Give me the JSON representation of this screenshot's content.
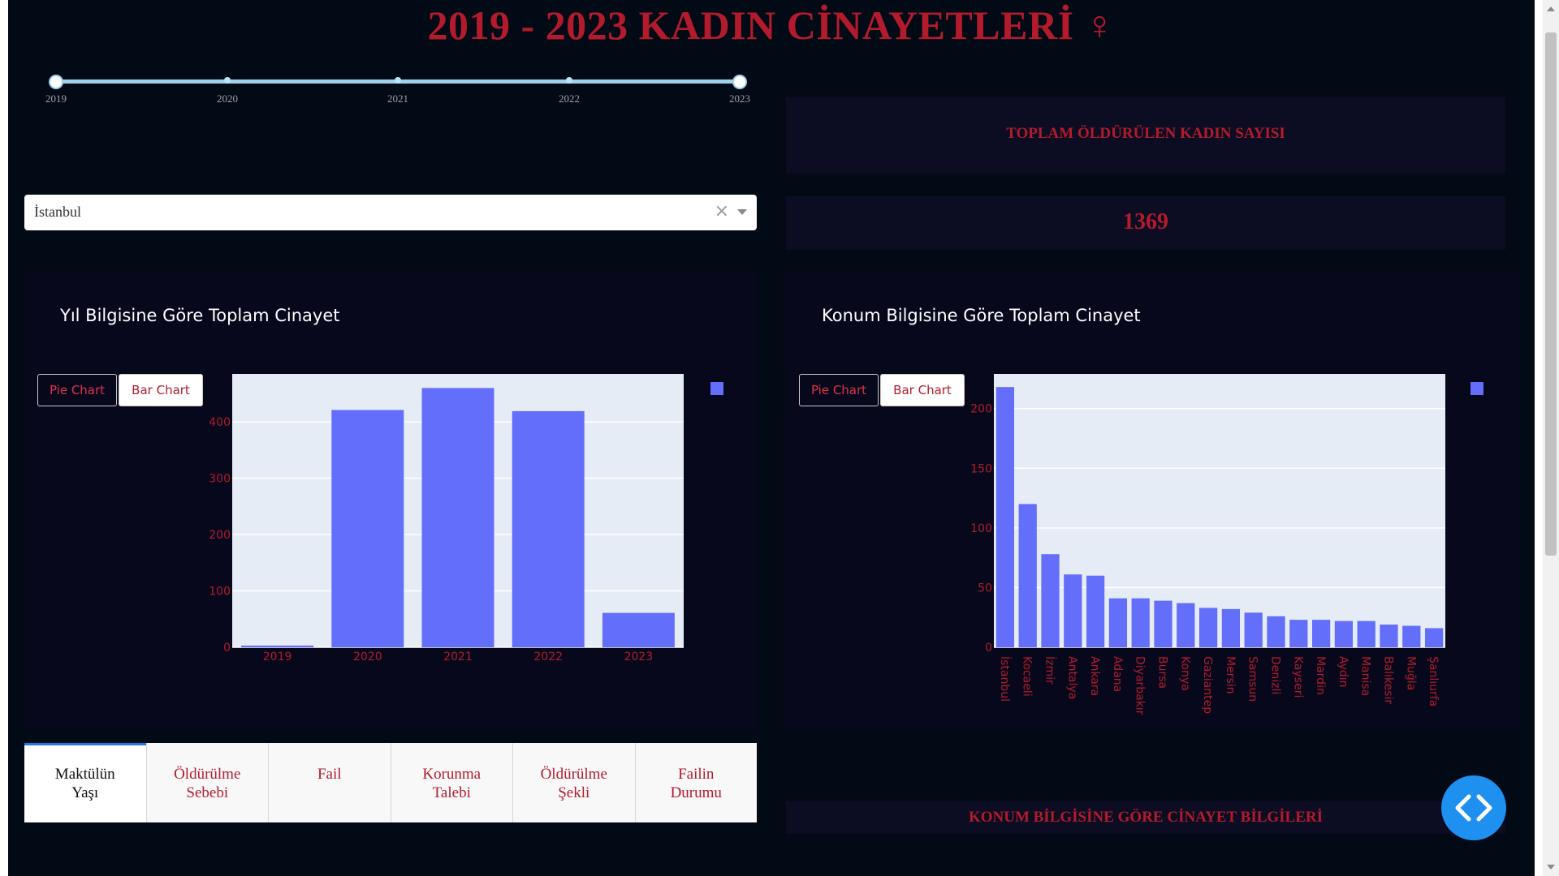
{
  "header": {
    "title": "2019 - 2023 KADIN CİNAYETLERİ ♀"
  },
  "slider": {
    "marks": [
      "2019",
      "2020",
      "2021",
      "2022",
      "2023"
    ],
    "selected_range": [
      "2019",
      "2023"
    ]
  },
  "dropdown": {
    "value": "İstanbul",
    "clear_symbol": "×"
  },
  "kpi": {
    "label": "TOPLAM ÖLDÜRÜLEN KADIN SAYISI",
    "value": "1369"
  },
  "left_panel": {
    "title": "Yıl Bilgisine Göre Toplam Cinayet",
    "pie_button": "Pie Chart",
    "bar_button": "Bar Chart"
  },
  "right_panel": {
    "title": "Konum Bilgisine Göre Toplam Cinayet",
    "pie_button": "Pie Chart",
    "bar_button": "Bar Chart"
  },
  "tabs": [
    {
      "line1": "Maktülün",
      "line2": "Yaşı"
    },
    {
      "line1": "Öldürülme",
      "line2": "Sebebi"
    },
    {
      "line1": "Fail",
      "line2": ""
    },
    {
      "line1": "Korunma",
      "line2": "Talebi"
    },
    {
      "line1": "Öldürülme",
      "line2": "Şekli"
    },
    {
      "line1": "Failin",
      "line2": "Durumu"
    }
  ],
  "active_tab": 0,
  "location_info_title": "KONUM BİLGİSİNE GÖRE CİNAYET BİLGİLERİ",
  "colors": {
    "accent": "#b31b2c",
    "bar": "#636efa",
    "plot_bg": "#e5ecf6",
    "panel_bg": "#07081c"
  },
  "chart_data": [
    {
      "type": "bar",
      "categories": [
        "2019",
        "2020",
        "2021",
        "2022",
        "2023"
      ],
      "values": [
        3,
        421,
        460,
        419,
        61
      ],
      "ylim": [
        0,
        485
      ],
      "yticks": [
        0,
        100,
        200,
        300,
        400
      ],
      "grid": true,
      "legend": "top-right"
    },
    {
      "type": "bar",
      "categories": [
        "İstanbul",
        "Kocaeli",
        "İzmir",
        "Antalya",
        "Ankara",
        "Adana",
        "Diyarbakır",
        "Bursa",
        "Konya",
        "Gaziantep",
        "Mersin",
        "Samsun",
        "Denizli",
        "Kayseri",
        "Mardin",
        "Aydın",
        "Manisa",
        "Balıkesir",
        "Muğla",
        "Şanlıurfa"
      ],
      "values": [
        218,
        120,
        78,
        61,
        60,
        41,
        41,
        39,
        37,
        33,
        32,
        29,
        26,
        23,
        23,
        22,
        22,
        19,
        18,
        16
      ],
      "ylim": [
        0,
        229
      ],
      "yticks": [
        0,
        50,
        100,
        150,
        200
      ],
      "grid": true,
      "legend": "top-right"
    }
  ]
}
